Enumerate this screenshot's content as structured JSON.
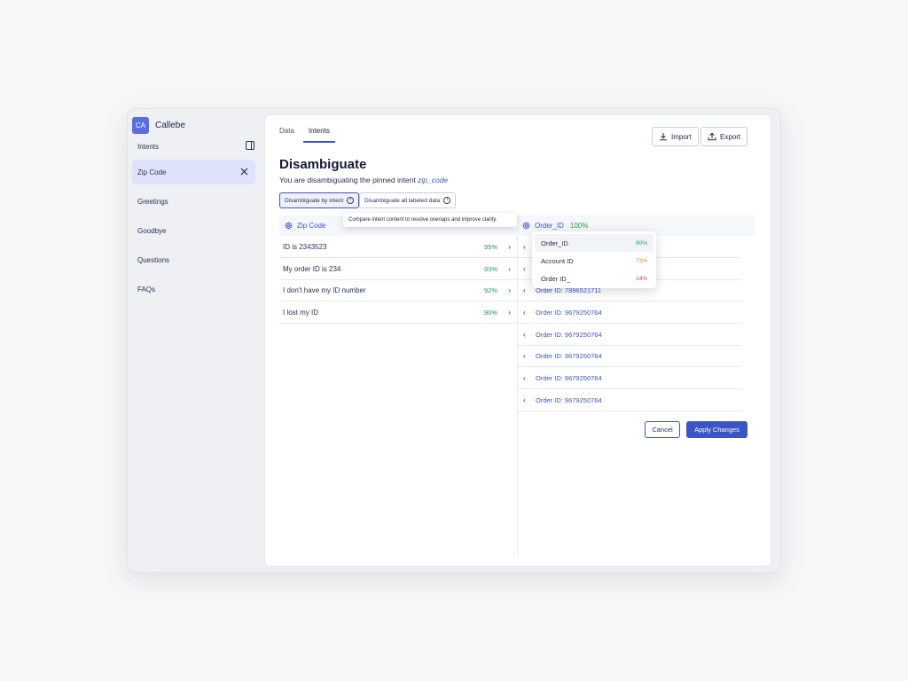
{
  "workspace": {
    "initials": "CA",
    "name": "Callebe"
  },
  "sidebar": {
    "section_label": "Intents",
    "items": [
      {
        "label": "Zip Code",
        "active": true
      },
      {
        "label": "Greetings"
      },
      {
        "label": "Goodbye"
      },
      {
        "label": "Questions"
      },
      {
        "label": "FAQs"
      }
    ]
  },
  "tabs": [
    {
      "label": "Data"
    },
    {
      "label": "Intents",
      "active": true
    }
  ],
  "header_buttons": {
    "import": "Import",
    "export": "Export"
  },
  "page": {
    "title": "Disambiguate",
    "subtitle_prefix": "You are disambiguating the pinned intent",
    "pinned_intent": "zip_code"
  },
  "modes": {
    "by_intent": "Disambiguate by intent",
    "all_labeled": "Disambiguate all labeled data"
  },
  "tooltip": "Compare intent content to resolve overlaps and improve clarity.",
  "left_column": {
    "header": "Zip Code",
    "rows": [
      {
        "text": "ID is 2343523",
        "pct": "95%"
      },
      {
        "text": "My order ID is 234",
        "pct": "93%"
      },
      {
        "text": "I don't have my ID number",
        "pct": "92%"
      },
      {
        "text": "I lost my ID",
        "pct": "90%"
      }
    ]
  },
  "right_column": {
    "header": "Order_ID",
    "header_pct": "100%",
    "rows": [
      {
        "text": ""
      },
      {
        "text": ""
      },
      {
        "text": "Order ID: 7896521711"
      },
      {
        "text": "Order ID: 9679250764"
      },
      {
        "text": "Order ID: 9679250764"
      },
      {
        "text": "Order ID: 9679250764"
      },
      {
        "text": "Order ID: 9679250764"
      },
      {
        "text": "Order ID: 9679250764"
      }
    ]
  },
  "dropdown": {
    "options": [
      {
        "label": "Order_ID",
        "pct": "90%",
        "color": "#1f9a59"
      },
      {
        "label": "Account ID",
        "pct": "73%",
        "color": "#e08a1e"
      },
      {
        "label": "Order ID_",
        "pct": "14%",
        "color": "#d63a3a"
      }
    ]
  },
  "actions": {
    "cancel": "Cancel",
    "apply": "Apply Changes"
  },
  "colors": {
    "accent": "#3b56c4",
    "success": "#1f9a59",
    "warning": "#e08a1e",
    "danger": "#d63a3a"
  }
}
